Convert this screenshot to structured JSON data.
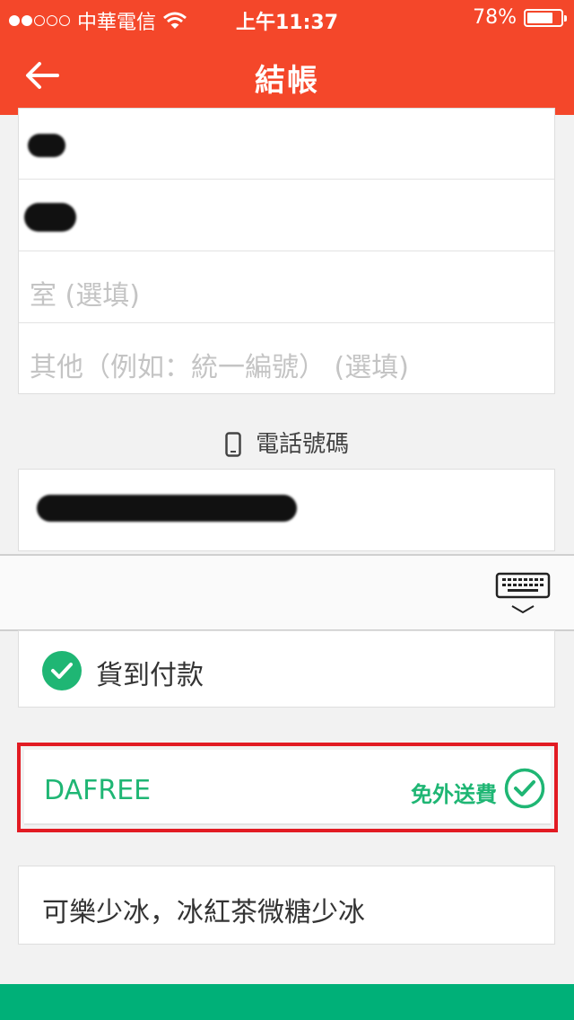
{
  "status_bar": {
    "carrier": "中華電信",
    "time": "上午11:37",
    "battery": "78%",
    "battery_level": 0.78,
    "signal_bars": 2
  },
  "nav": {
    "title": "結帳",
    "back_icon": "arrow-left-icon"
  },
  "address_fields": {
    "room_placeholder": "室 (選填)",
    "other_placeholder": "其他（例如：統一編號） (選填)"
  },
  "phone": {
    "label": "電話號碼",
    "icon": "phone-icon"
  },
  "keyboard_toolbar": {
    "icon": "keyboard-hide-icon"
  },
  "payment": {
    "label": "貨到付款",
    "selected": true
  },
  "promo": {
    "code": "DAFREE",
    "badge": "免外送費"
  },
  "note": {
    "value": "可樂少冰，冰紅茶微糖少冰"
  },
  "colors": {
    "header": "#f4472a",
    "accent_green": "#1fb674",
    "highlight_red": "#e21b23",
    "bottom_bar": "#00b078"
  }
}
